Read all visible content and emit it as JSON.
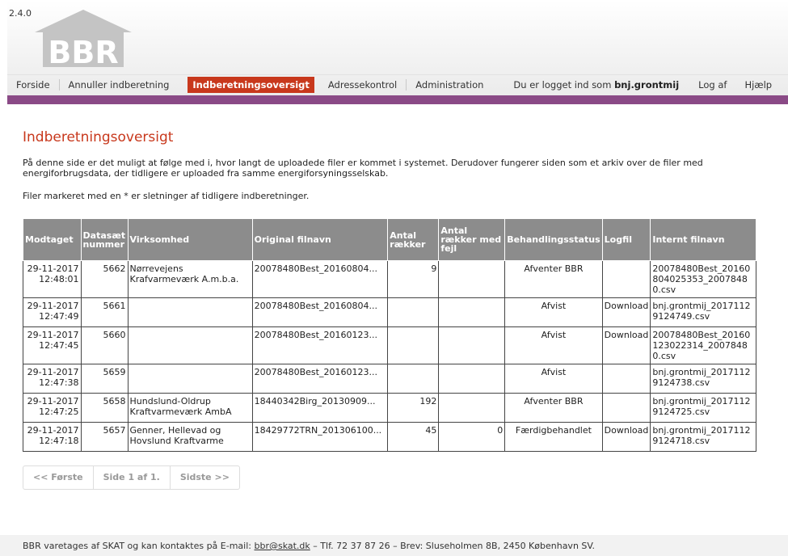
{
  "app": {
    "version": "2.4.0",
    "logo_text": "BBR"
  },
  "nav": {
    "items": [
      {
        "label": "Forside"
      },
      {
        "label": "Annuller indberetning"
      },
      {
        "label": "Indberetningsoversigt",
        "active": true
      },
      {
        "label": "Adressekontrol"
      },
      {
        "label": "Administration"
      }
    ],
    "login_prefix": "Du er logget ind som",
    "username": "bnj.grontmij",
    "logout": "Log af",
    "help": "Hjælp"
  },
  "page": {
    "title": "Indberetningsoversigt",
    "intro": "På denne side er det muligt at følge med i, hvor langt de uploadede filer er kommet i systemet. Derudover fungerer siden som et arkiv over de filer med energiforbrugsdata, der tidligere er uploaded fra samme energiforsyningsselskab.",
    "note": "Filer markeret med en * er sletninger af tidligere indberetninger."
  },
  "table": {
    "headers": [
      "Modtaget",
      "Datasæt nummer",
      "Virksomhed",
      "Original filnavn",
      "Antal rækker",
      "Antal rækker med fejl",
      "Behandlingsstatus",
      "Logfil",
      "Internt filnavn"
    ],
    "rows": [
      {
        "modtaget": "29-11-2017 12:48:01",
        "nummer": "5662",
        "virksomhed": "Nørrevejens Krafvarmeværk A.m.b.a.",
        "original": "20078480Best_20160804...",
        "antal": "9",
        "fejl": "",
        "status": "Afventer BBR",
        "logfil": "",
        "internt": "20078480Best_20160804025353_20078480.csv"
      },
      {
        "modtaget": "29-11-2017 12:47:49",
        "nummer": "5661",
        "virksomhed": "",
        "original": "20078480Best_20160804...",
        "antal": "",
        "fejl": "",
        "status": "Afvist",
        "logfil": "Download",
        "internt": "bnj.grontmij_20171129124749.csv"
      },
      {
        "modtaget": "29-11-2017 12:47:45",
        "nummer": "5660",
        "virksomhed": "",
        "original": "20078480Best_20160123...",
        "antal": "",
        "fejl": "",
        "status": "Afvist",
        "logfil": "Download",
        "internt": "20078480Best_20160123022314_20078480.csv"
      },
      {
        "modtaget": "29-11-2017 12:47:38",
        "nummer": "5659",
        "virksomhed": "",
        "original": "20078480Best_20160123...",
        "antal": "",
        "fejl": "",
        "status": "Afvist",
        "logfil": "",
        "internt": "bnj.grontmij_20171129124738.csv"
      },
      {
        "modtaget": "29-11-2017 12:47:25",
        "nummer": "5658",
        "virksomhed": "Hundslund-Oldrup Kraftvarmeværk AmbA",
        "original": "18440342Birg_20130909...",
        "antal": "192",
        "fejl": "",
        "status": "Afventer BBR",
        "logfil": "",
        "internt": "bnj.grontmij_20171129124725.csv"
      },
      {
        "modtaget": "29-11-2017 12:47:18",
        "nummer": "5657",
        "virksomhed": "Genner, Hellevad og Hovslund Kraftvarme",
        "original": "18429772TRN_201306100...",
        "antal": "45",
        "fejl": "0",
        "status": "Færdigbehandlet",
        "logfil": "Download",
        "internt": "bnj.grontmij_20171129124718.csv"
      }
    ]
  },
  "pager": {
    "first": "<< Første",
    "info": "Side 1 af 1.",
    "last": "Sidste >>"
  },
  "footer": {
    "prefix": "BBR varetages af SKAT og kan kontaktes på E-mail:",
    "email": "bbr@skat.dk",
    "suffix": "– Tlf. 72 37 87 26 – Brev: Sluseholmen 8B, 2450 København SV."
  },
  "colors": {
    "accent": "#c8381c",
    "bar": "#8a4a86",
    "table_header": "#8c8c8c"
  }
}
